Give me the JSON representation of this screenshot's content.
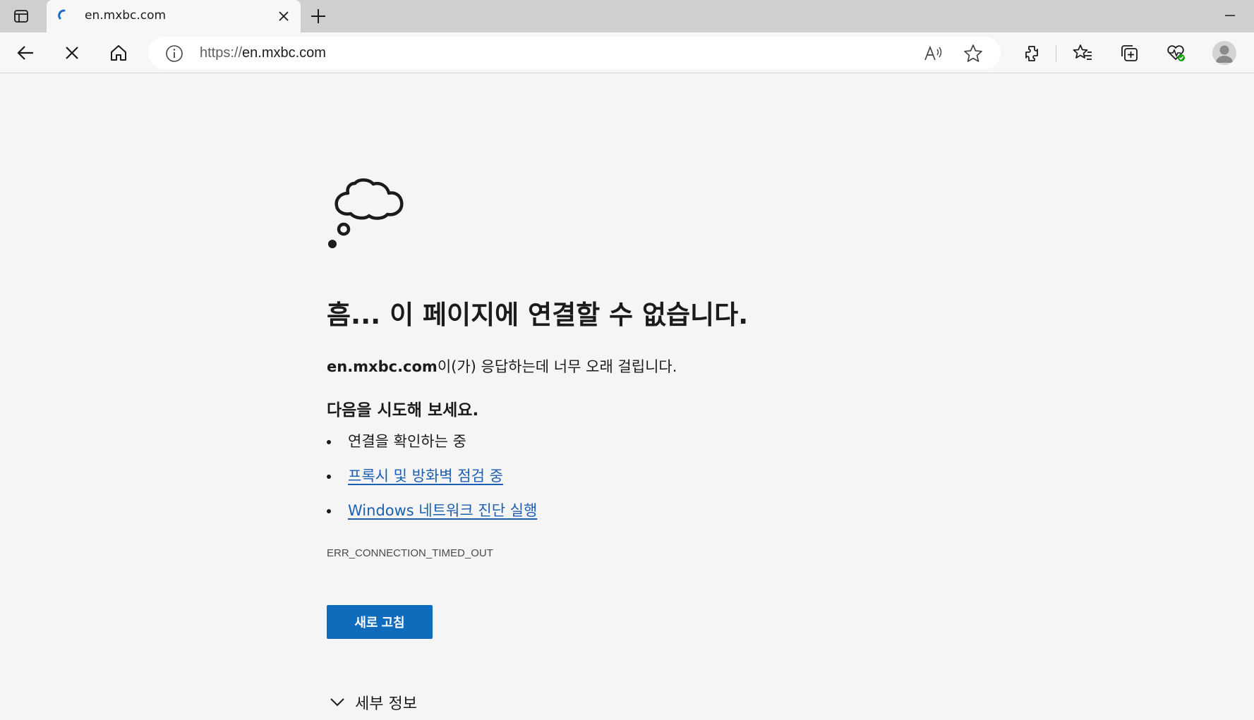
{
  "tab": {
    "title": "en.mxbc.com",
    "favicon": "loading-spinner-icon"
  },
  "toolbar": {
    "back": "back-arrow-icon",
    "stop": "stop-icon",
    "home": "home-icon",
    "url_protocol": "https://",
    "url_host": "en.mxbc.com",
    "icons": [
      "read-aloud-icon",
      "favorite-star-icon",
      "extensions-icon",
      "favorites-icon",
      "collections-icon",
      "browser-essentials-icon",
      "profile-icon"
    ]
  },
  "error_page": {
    "title": "흠... 이 페이지에 연결할 수 없습니다.",
    "host": "en.mxbc.com",
    "description_suffix": "이(가) 응답하는데 너무 오래 걸립니다.",
    "try_heading": "다음을 시도해 보세요.",
    "suggestions": [
      {
        "text": "연결을 확인하는 중",
        "link": false
      },
      {
        "text": "프록시 및 방화벽 점검 중",
        "link": true
      },
      {
        "text": "Windows 네트워크 진단 실행",
        "link": true
      }
    ],
    "error_code": "ERR_CONNECTION_TIMED_OUT",
    "refresh_label": "새로 고침",
    "details_label": "세부 정보"
  },
  "colors": {
    "accent": "#0f6cbd",
    "link": "#1b5fb4",
    "page_bg": "#f5f5f5",
    "tabstrip_bg": "#cfcfcf"
  }
}
